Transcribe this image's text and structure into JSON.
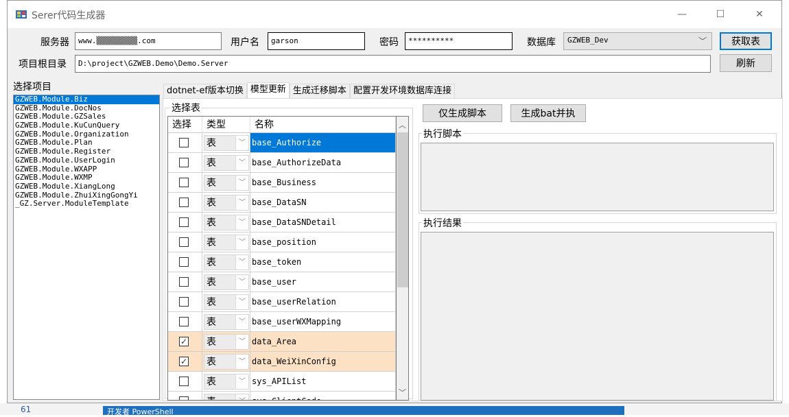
{
  "window": {
    "title": "Serer代码生成器",
    "min_glyph": "—",
    "max_glyph": "☐",
    "close_glyph": "✕"
  },
  "form": {
    "server_label": "服务器",
    "server_value": "www.▒▒▒▒▒▒▒▒▒.com",
    "user_label": "用户名",
    "user_value": "garson",
    "password_label": "密码",
    "password_value": "**********",
    "db_label": "数据库",
    "db_value": "GZWEB_Dev",
    "get_tables_button": "获取表",
    "root_label": "项目根目录",
    "root_value": "D:\\project\\GZWEB.Demo\\Demo.Server",
    "refresh_button": "刷新"
  },
  "projects": {
    "label": "选择项目",
    "items": [
      "GZWEB.Module.Biz",
      "GZWEB.Module.DocNos",
      "GZWEB.Module.GZSales",
      "GZWEB.Module.KuCunQuery",
      "GZWEB.Module.Organization",
      "GZWEB.Module.Plan",
      "GZWEB.Module.Register",
      "GZWEB.Module.UserLogin",
      "GZWEB.Module.WXAPP",
      "GZWEB.Module.WXMP",
      "GZWEB.Module.XiangLong",
      "GZWEB.Module.ZhuiXingGongYi",
      "_GZ.Server.ModuleTemplate"
    ],
    "selected_index": 0
  },
  "tabs": [
    "dotnet-ef版本切换",
    "模型更新",
    "生成迁移脚本",
    "配置开发环境数据库连接"
  ],
  "active_tab": 1,
  "table_group": {
    "title": "选择表",
    "headers": {
      "select": "选择",
      "type": "类型",
      "name": "名称"
    },
    "rows": [
      {
        "checked": false,
        "type": "表",
        "name": "base_Authorize",
        "state": "selected"
      },
      {
        "checked": false,
        "type": "表",
        "name": "base_AuthorizeData",
        "state": "normal"
      },
      {
        "checked": false,
        "type": "表",
        "name": "base_Business",
        "state": "normal"
      },
      {
        "checked": false,
        "type": "表",
        "name": "base_DataSN",
        "state": "normal"
      },
      {
        "checked": false,
        "type": "表",
        "name": "base_DataSNDetail",
        "state": "normal"
      },
      {
        "checked": false,
        "type": "表",
        "name": "base_position",
        "state": "normal"
      },
      {
        "checked": false,
        "type": "表",
        "name": "base_token",
        "state": "normal"
      },
      {
        "checked": false,
        "type": "表",
        "name": "base_user",
        "state": "normal"
      },
      {
        "checked": false,
        "type": "表",
        "name": "base_userRelation",
        "state": "normal"
      },
      {
        "checked": false,
        "type": "表",
        "name": "base_userWXMapping",
        "state": "normal"
      },
      {
        "checked": true,
        "type": "表",
        "name": "data_Area",
        "state": "checked"
      },
      {
        "checked": true,
        "type": "表",
        "name": "data_WeiXinConfig",
        "state": "checked"
      },
      {
        "checked": false,
        "type": "表",
        "name": "sys_APIList",
        "state": "normal"
      },
      {
        "checked": false,
        "type": "表",
        "name": "sys_ClientCode",
        "state": "normal"
      }
    ]
  },
  "actions": {
    "gen_script_button": "仅生成脚本",
    "gen_bat_button": "生成bat并执",
    "exec_script_label": "执行脚本",
    "exec_result_label": "执行结果"
  },
  "colors": {
    "selected_row": "#0078d7",
    "checked_row": "#fde1c4",
    "default_button_border": "#0078d7"
  },
  "background": {
    "line_number": "61",
    "taskbar_text": "开发者 PowerShell"
  }
}
